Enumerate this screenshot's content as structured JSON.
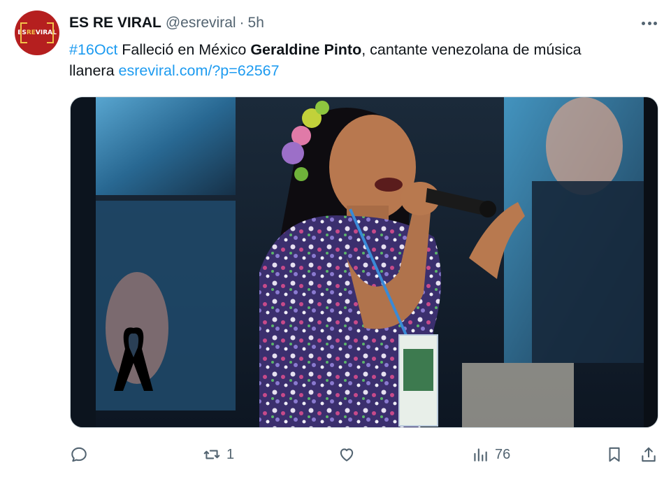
{
  "account": {
    "display_name": "ES RE VIRAL",
    "handle": "@esreviral",
    "separator": "·",
    "time": "5h",
    "avatar_logo_a": "ES",
    "avatar_logo_b": "RE",
    "avatar_logo_c": "VIRAL",
    "avatar_color": "#b51f1f"
  },
  "tweet": {
    "hashtag": "#16Oct",
    "text_part1": " Falleció en México ",
    "bold_name": "Geraldine Pinto",
    "text_part2": ", cantante venezolana de música llanera ",
    "link": "esreviral.com/?p=62567"
  },
  "actions": {
    "reply_icon": "reply-icon",
    "retweet_icon": "retweet-icon",
    "retweet_count": "1",
    "like_icon": "heart-icon",
    "views_icon": "views-chart-icon",
    "views_count": "76",
    "bookmark_icon": "bookmark-icon",
    "share_icon": "share-icon"
  },
  "colors": {
    "link": "#1d9bf0",
    "secondary_text": "#536471",
    "primary_text": "#0f1419"
  }
}
